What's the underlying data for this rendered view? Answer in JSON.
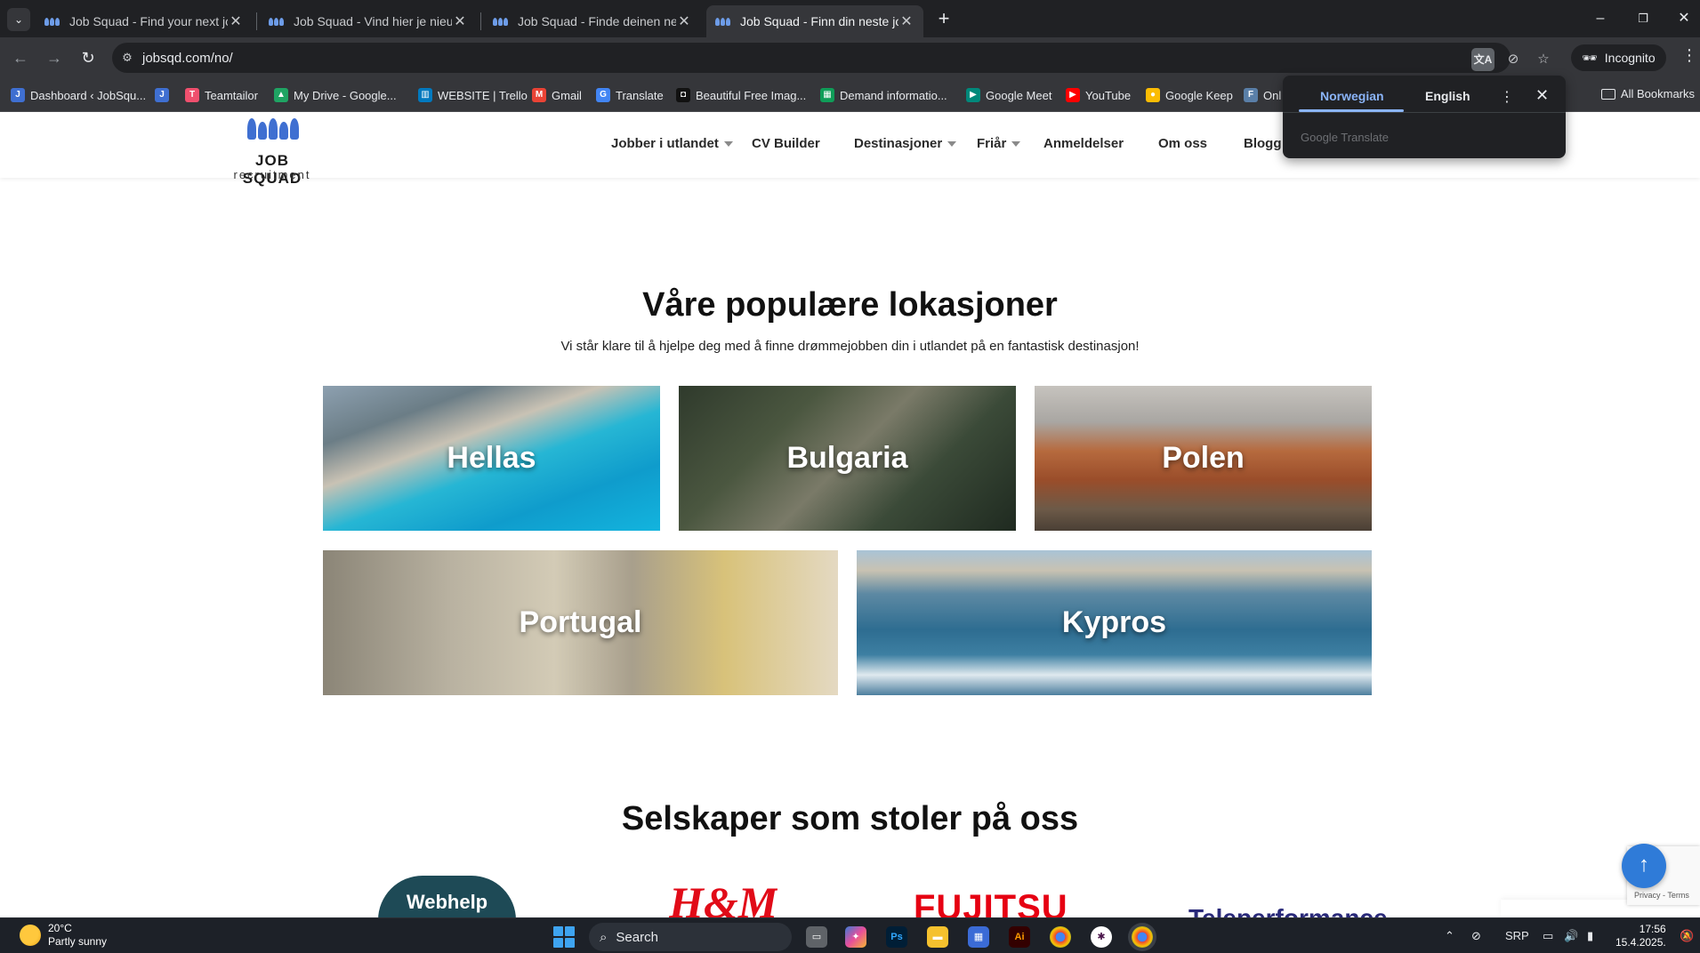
{
  "browser": {
    "tabs": [
      {
        "title": "Job Squad - Find your next job",
        "active": false
      },
      {
        "title": "Job Squad - Vind hier je nieuwe",
        "active": false
      },
      {
        "title": "Job Squad - Finde deinen neuen",
        "active": false
      },
      {
        "title": "Job Squad - Finn din neste jobb",
        "active": true
      }
    ],
    "url": "jobsqd.com/no/",
    "incognito_label": "Incognito",
    "bookmarks": [
      "Dashboard ‹ JobSqu...",
      "Teamtailor",
      "My Drive - Google...",
      "WEBSITE | Trello",
      "Gmail",
      "Translate",
      "Beautiful Free Imag...",
      "Demand informatio...",
      "Google Meet",
      "YouTube",
      "Google Keep",
      "Onl"
    ],
    "all_bookmarks_label": "All Bookmarks"
  },
  "translate_popup": {
    "source_lang": "Norwegian",
    "target_lang": "English",
    "brand": "Google Translate"
  },
  "site": {
    "logo": {
      "brand": "JOB SQUAD",
      "sub": "recruitment"
    },
    "menu": [
      {
        "label": "Jobber i utlandet",
        "dropdown": true
      },
      {
        "label": "CV Builder",
        "dropdown": false
      },
      {
        "label": "Destinasjoner",
        "dropdown": true
      },
      {
        "label": "Friår",
        "dropdown": true
      },
      {
        "label": "Anmeldelser",
        "dropdown": false
      },
      {
        "label": "Om oss",
        "dropdown": false
      },
      {
        "label": "Blogg",
        "dropdown": false
      }
    ],
    "locations_section": {
      "title": "Våre populære lokasjoner",
      "subtitle": "Vi står klare til å hjelpe deg med å finne drømmejobben din i utlandet på en fantastisk destinasjon!",
      "locations": [
        "Hellas",
        "Bulgaria",
        "Polen",
        "Portugal",
        "Kypros"
      ]
    },
    "clients_section": {
      "title": "Selskaper som stoler på oss",
      "clients": [
        "Webhelp",
        "H&M",
        "FUJITSU",
        "Teleperformance"
      ]
    },
    "recaptcha_text": "Privacy - Terms"
  },
  "taskbar": {
    "weather_temp": "20°C",
    "weather_desc": "Partly sunny",
    "search_label": "Search",
    "lang": "SRP",
    "time": "17:56",
    "date": "15.4.2025."
  },
  "colors": {
    "brand_blue": "#3f6fd1",
    "scroll_button": "#2f7bd8",
    "chrome_dark": "#202124",
    "chrome_toolbar": "#35363a"
  }
}
